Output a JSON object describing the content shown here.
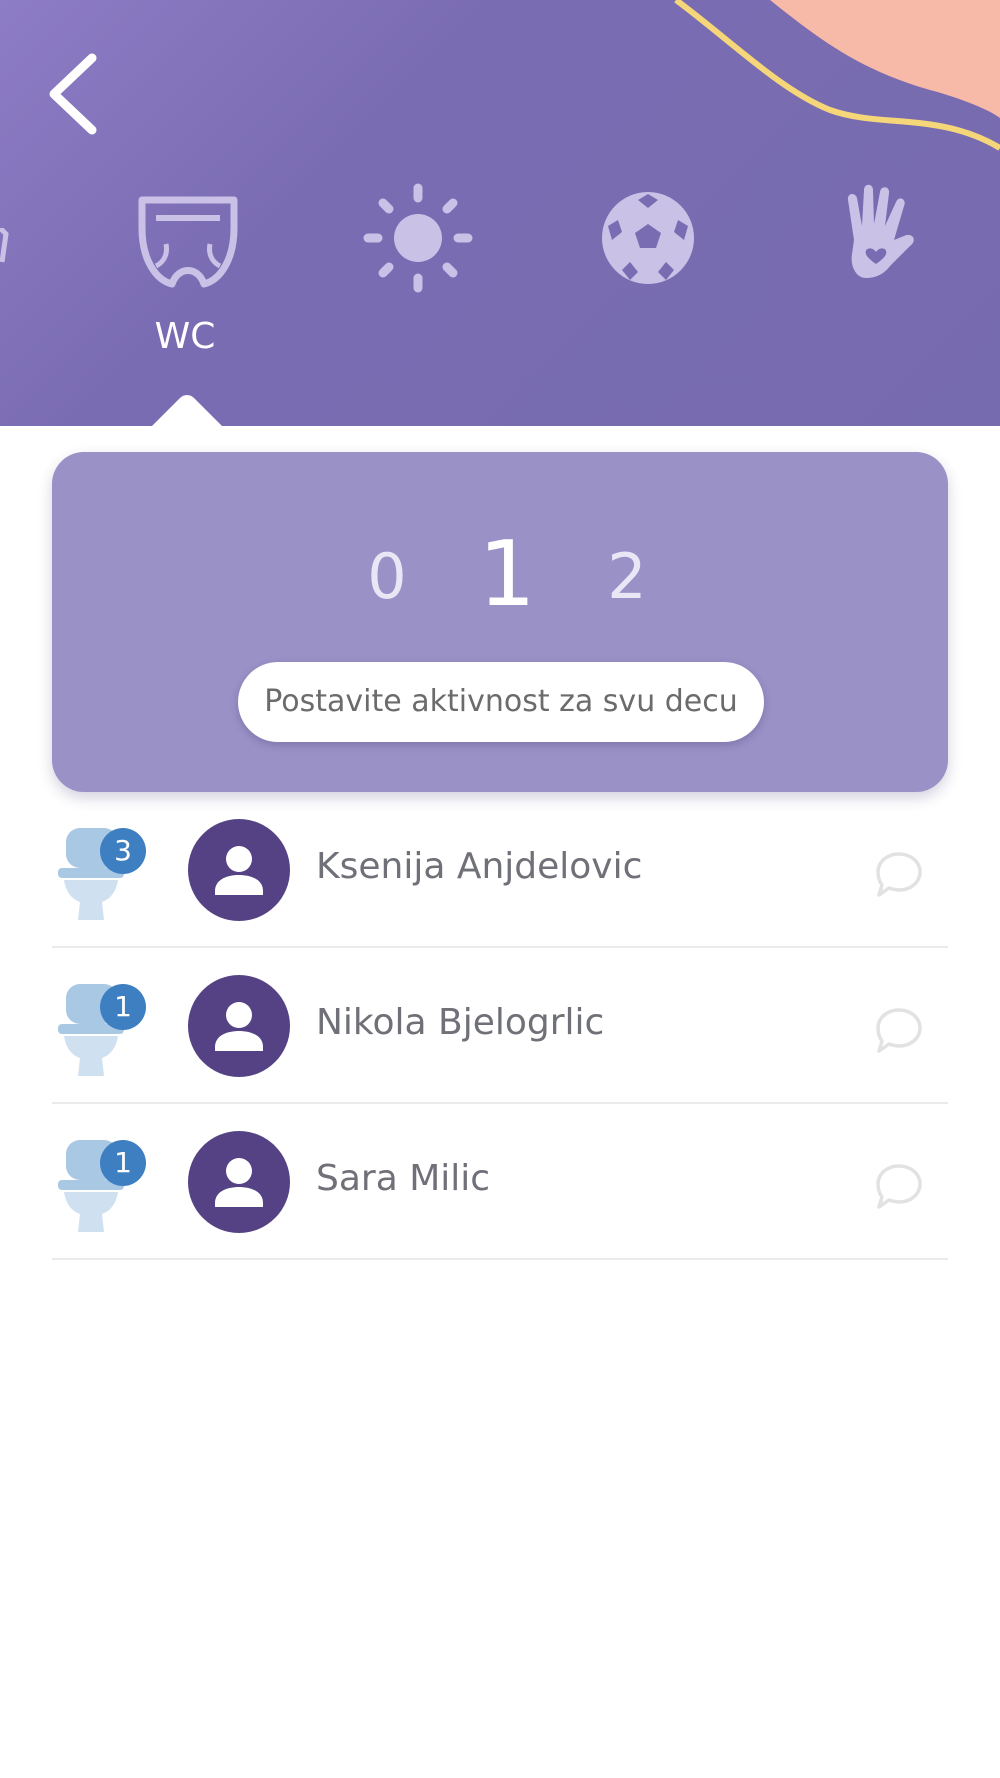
{
  "colors": {
    "header_bg": "#7a6cb2",
    "card_bg": "#9a91c6",
    "avatar_bg": "#544285",
    "badge_bg": "#3d7fc0",
    "accent_yellow": "#f5d77a",
    "accent_peach": "#f7b9a8"
  },
  "header": {
    "back_icon": "chevron-left-icon",
    "categories": [
      {
        "icon": "diaper-icon",
        "label": "WC",
        "selected": true
      },
      {
        "icon": "sun-icon",
        "label": "",
        "selected": false
      },
      {
        "icon": "soccer-ball-icon",
        "label": "",
        "selected": false
      },
      {
        "icon": "hand-heart-icon",
        "label": "",
        "selected": false
      }
    ]
  },
  "counter": {
    "options": [
      "0",
      "1",
      "2"
    ],
    "selected": "1",
    "set_all_label": "Postavite aktivnost za svu decu"
  },
  "children": [
    {
      "name": "Ksenija Anjdelovic",
      "count": "3"
    },
    {
      "name": "Nikola Bjelogrlic",
      "count": "1"
    },
    {
      "name": "Sara Milic",
      "count": "1"
    }
  ]
}
